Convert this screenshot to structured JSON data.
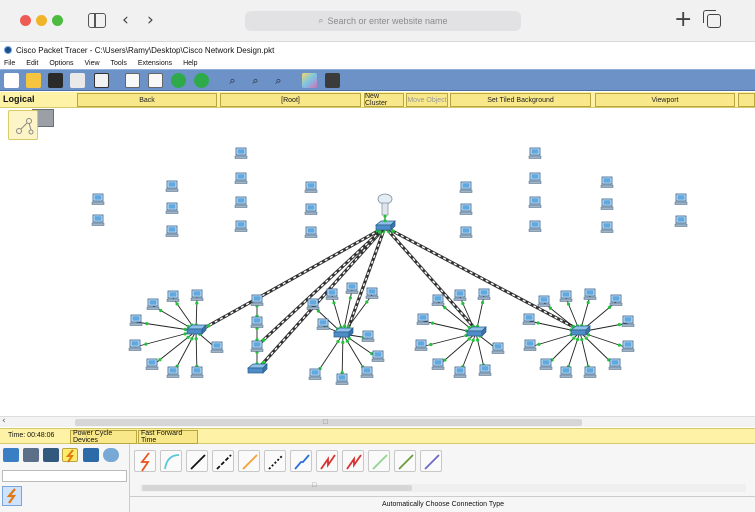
{
  "browser": {
    "url_placeholder": "Search or enter website name",
    "back_glyph": "‹",
    "forward_glyph": "›",
    "new_tab_glyph": "+"
  },
  "app": {
    "title": "Cisco Packet Tracer - C:\\Users\\Ramy\\Desktop\\Cisco Network Design.pkt",
    "menu": [
      "File",
      "Edit",
      "Options",
      "View",
      "Tools",
      "Extensions",
      "Help"
    ]
  },
  "toolbar": {
    "icons": [
      "new-file-icon",
      "open-folder-icon",
      "save-icon",
      "print-icon",
      "activity-wizard-icon",
      "copy-icon",
      "paste-icon",
      "undo-icon",
      "redo-icon",
      "zoom-in-icon",
      "zoom-reset-icon",
      "zoom-out-icon",
      "palette-icon",
      "custom-device-icon"
    ]
  },
  "logical_bar": {
    "label": "Logical",
    "buttons": {
      "back": "Back",
      "root": "[Root]",
      "new_cluster": "New Cluster",
      "move_object": "Move Object",
      "tiled_background": "Set Tiled Background",
      "viewport": "Viewport"
    }
  },
  "status": {
    "time": "Time: 00:48:06",
    "power_cycle": "Power Cycle Devices",
    "fast_forward": "Fast Forward Time"
  },
  "device_panel": {
    "categories": [
      "network-devices-icon",
      "end-devices-icon",
      "components-icon",
      "connections-icon",
      "misc-icon",
      "multiuser-icon"
    ],
    "selected_category": "connections-icon"
  },
  "connections": {
    "types": [
      {
        "name": "automatic-connection-icon",
        "color": "#e8541d"
      },
      {
        "name": "console-cable-icon",
        "color": "#5bc8d8"
      },
      {
        "name": "copper-straight-through-icon",
        "color": "#111111"
      },
      {
        "name": "copper-cross-over-icon",
        "color": "#111111"
      },
      {
        "name": "fiber-icon",
        "color": "#f0a030"
      },
      {
        "name": "phone-cable-icon",
        "color": "#111111"
      },
      {
        "name": "coaxial-icon",
        "color": "#2b6fd6"
      },
      {
        "name": "serial-dce-icon",
        "color": "#d63232"
      },
      {
        "name": "serial-dte-icon",
        "color": "#d63232"
      },
      {
        "name": "octal-cable-icon",
        "color": "#8fd48f"
      },
      {
        "name": "iot-custom-cable-icon",
        "color": "#6a9a3a"
      },
      {
        "name": "usb-cable-icon",
        "color": "#6a6ac8"
      }
    ],
    "description": "Automatically Choose Connection Type"
  },
  "topology": {
    "colors": {
      "link": "#333333",
      "link_alt": "#8a8a8a",
      "green_end": "#22c33a"
    }
  }
}
